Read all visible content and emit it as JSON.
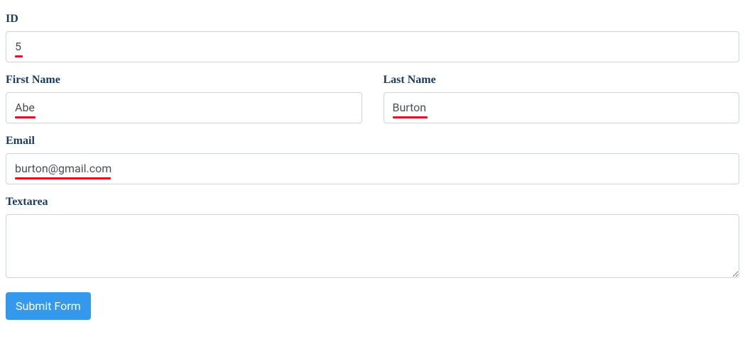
{
  "form": {
    "id": {
      "label": "ID",
      "value": "5"
    },
    "first_name": {
      "label": "First Name",
      "value": "Abe"
    },
    "last_name": {
      "label": "Last Name",
      "value": "Burton"
    },
    "email": {
      "label": "Email",
      "value": "burton@gmail.com"
    },
    "textarea": {
      "label": "Textarea",
      "value": ""
    },
    "submit_label": "Submit Form"
  }
}
